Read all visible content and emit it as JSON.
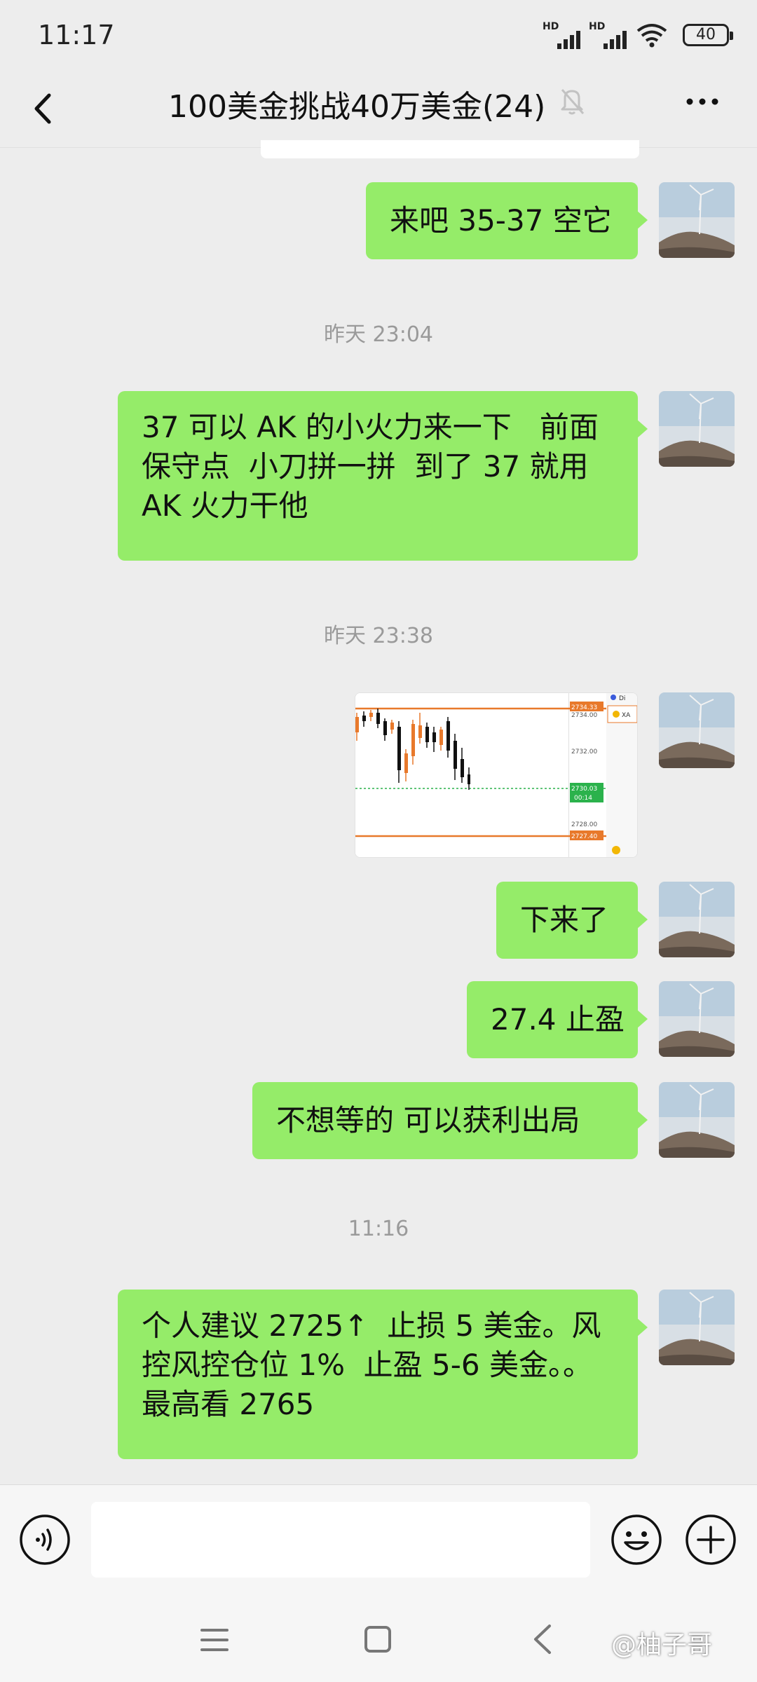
{
  "status_bar": {
    "time": "11:17",
    "signal1_label": "HD",
    "signal2_label": "HD",
    "battery_level": "40"
  },
  "header": {
    "title": "100美金挑战40万美金(24)",
    "back_icon": "chevron-left-icon",
    "mute_icon": "bell-off-icon",
    "more_icon": "more-dots-icon"
  },
  "messages": {
    "m1": "来吧 35-37 空它",
    "t1": "昨天 23:04",
    "m2": {
      "line1": "37 可以 AK 的小火力来一下   前面",
      "line2": "保守点  小刀拼一拼  到了 37 就用",
      "line3": "AK 火力干他"
    },
    "t2": "昨天 23:38",
    "m4": "下来了",
    "m5": "27.4 止盈",
    "m6": "不想等的  可以获利出局",
    "t3": "11:16",
    "m7": {
      "line1": "个人建议 2725↑  止损 5 美金。风",
      "line2": "控风控仓位 1%  止盈 5-6 美金。。",
      "line3": "最高看 2765"
    }
  },
  "chart_image": {
    "price_top": "2734.33",
    "price_1": "2734.00",
    "price_2": "2732.00",
    "price_current": "2730.03",
    "countdown": "00:14",
    "price_3": "2728.00",
    "price_bottom": "2727.40",
    "tag_a": "Di",
    "tag_b": "XA"
  },
  "input_bar": {
    "voice_icon": "voice-icon",
    "emoji_icon": "emoji-icon",
    "plus_icon": "plus-icon"
  },
  "watermark": "@柚子哥",
  "colors": {
    "bubble_green": "#95ec69",
    "background": "#ededed",
    "bearish": "#111111",
    "bullish": "#e8792b"
  }
}
